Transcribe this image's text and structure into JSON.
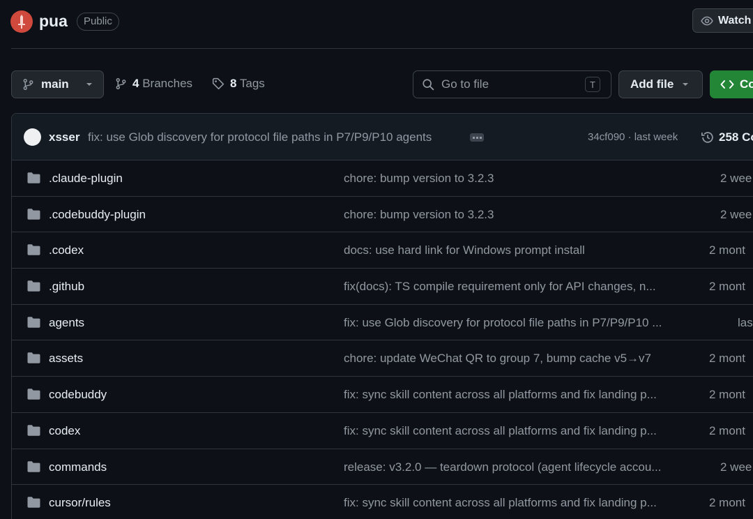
{
  "repo": {
    "name": "pua",
    "visibility": "Public",
    "watch_label": "Watch"
  },
  "toolbar": {
    "branch": "main",
    "branches_count": "4",
    "branches_label": "Branches",
    "tags_count": "8",
    "tags_label": "Tags",
    "search_placeholder": "Go to file",
    "search_shortcut": "T",
    "add_file_label": "Add file",
    "code_label": "Co"
  },
  "latest_commit": {
    "author": "xsser",
    "message": "fix: use Glob discovery for protocol file paths in P7/P9/P10 agents",
    "hash_time": "34cf090 · last week",
    "commits_label": "258 Co"
  },
  "files": [
    {
      "name": ".claude-plugin",
      "message": "chore: bump version to 3.2.3",
      "date": "2 wee"
    },
    {
      "name": ".codebuddy-plugin",
      "message": "chore: bump version to 3.2.3",
      "date": "2 wee"
    },
    {
      "name": ".codex",
      "message": "docs: use hard link for Windows prompt install",
      "date": "2 mont"
    },
    {
      "name": ".github",
      "message": "fix(docs): TS compile requirement only for API changes, n...",
      "date": "2 mont"
    },
    {
      "name": "agents",
      "message": "fix: use Glob discovery for protocol file paths in P7/P9/P10 ...",
      "date": "las"
    },
    {
      "name": "assets",
      "message": "chore: update WeChat QR to group 7, bump cache v5→v7",
      "date": "2 mont"
    },
    {
      "name": "codebuddy",
      "message": "fix: sync skill content across all platforms and fix landing p...",
      "date": "2 mont"
    },
    {
      "name": "codex",
      "message": "fix: sync skill content across all platforms and fix landing p...",
      "date": "2 mont"
    },
    {
      "name": "commands",
      "message": "release: v3.2.0 — teardown protocol (agent lifecycle accou...",
      "date": "2 wee"
    },
    {
      "name": "cursor/rules",
      "message": "fix: sync skill content across all platforms and fix landing p...",
      "date": "2 mont"
    }
  ],
  "colors": {
    "background": "#0d1117",
    "border": "#30363d",
    "muted_text": "#9198a1",
    "primary_text": "#e6edf3",
    "code_button": "#238636",
    "logo": "#cf4a3c",
    "folder_icon": "#9198a1"
  },
  "icons": {
    "logo": "sword-logo-icon",
    "watch": "eye-icon",
    "branch": "git-branch-icon",
    "tag": "tag-icon",
    "search": "search-icon",
    "code": "code-icon",
    "history": "history-icon",
    "folder": "folder-icon",
    "dropdown": "triangle-down-icon"
  }
}
